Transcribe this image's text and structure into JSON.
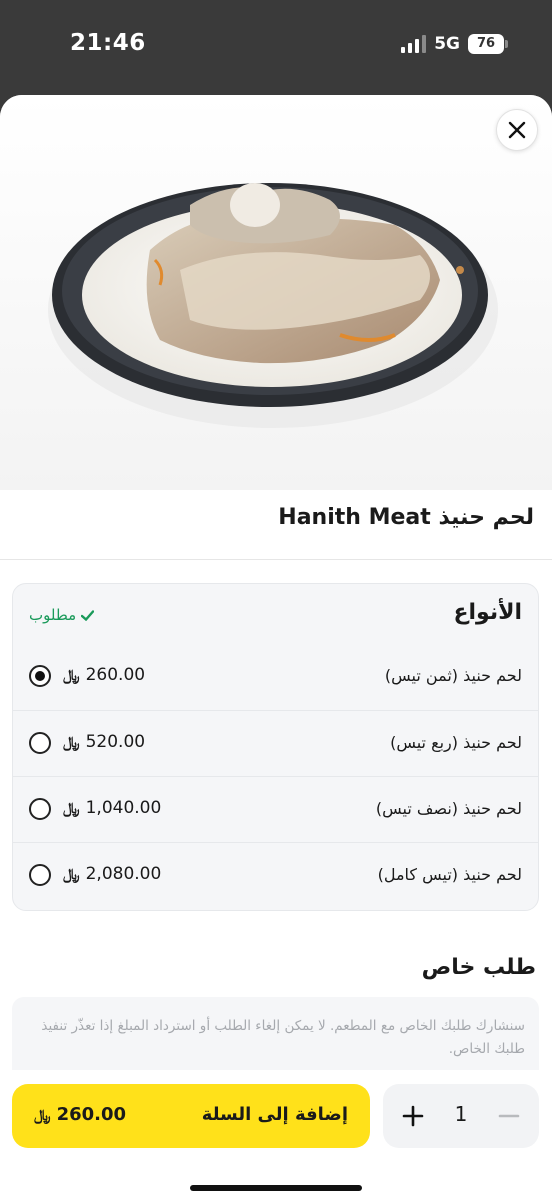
{
  "status_bar": {
    "time": "21:46",
    "network": "5G",
    "battery": "76"
  },
  "item": {
    "title": "لحم حنيذ Hanith Meat",
    "image_icon": "food-plate-image"
  },
  "options": {
    "title": "الأنواع",
    "required_label": "مطلوب",
    "currency_symbol": "﷼",
    "selected_index": 0,
    "items": [
      {
        "label": "لحم حنيذ (ثمن تيس)",
        "price": "260.00"
      },
      {
        "label": "لحم حنيذ (ربع تيس)",
        "price": "520.00"
      },
      {
        "label": "لحم حنيذ (نصف تيس)",
        "price": "1,040.00"
      },
      {
        "label": "لحم حنيذ (تيس كامل)",
        "price": "2,080.00"
      }
    ]
  },
  "special_request": {
    "title": "طلب خاص",
    "placeholder": "سنشارك طلبك الخاص مع المطعم. لا يمكن إلغاء الطلب أو استرداد المبلغ إذا تعذّر تنفيذ طلبك الخاص."
  },
  "cart": {
    "add_label": "إضافة إلى السلة",
    "total": "260.00",
    "quantity": "1"
  },
  "colors": {
    "accent": "#ffe11a",
    "required": "#1a9a5a"
  }
}
